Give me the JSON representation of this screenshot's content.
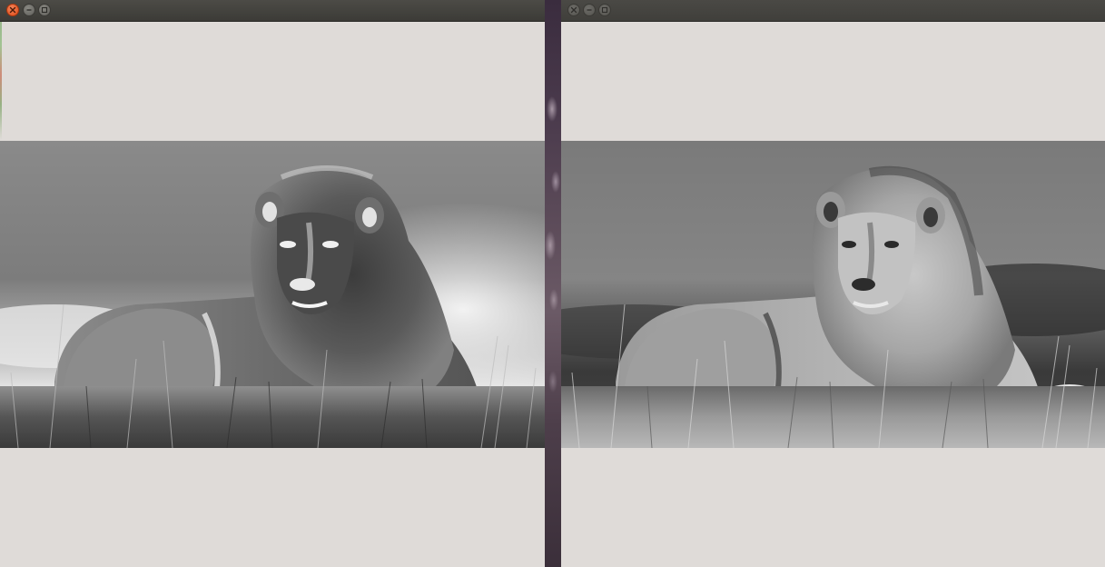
{
  "desktop": {
    "background": "#2b2430"
  },
  "windows": [
    {
      "id": "left",
      "title": "",
      "state": "active",
      "controls": [
        "close-icon",
        "minimize-icon",
        "maximize-icon"
      ],
      "content": {
        "background": "#dfdbd8",
        "image": {
          "description_type": "grayscale-photo-lion",
          "variant": "inverted-tone-processed"
        }
      }
    },
    {
      "id": "right",
      "title": "",
      "state": "inactive",
      "controls": [
        "close-icon",
        "minimize-icon",
        "maximize-icon"
      ],
      "content": {
        "background": "#dfdbd8",
        "image": {
          "description_type": "grayscale-photo-lion",
          "variant": "original-grayscale"
        }
      }
    }
  ],
  "colors": {
    "titlebar": "#3c3b37",
    "close_button_active": "#df4a16",
    "window_bg": "#dfdbd8"
  }
}
